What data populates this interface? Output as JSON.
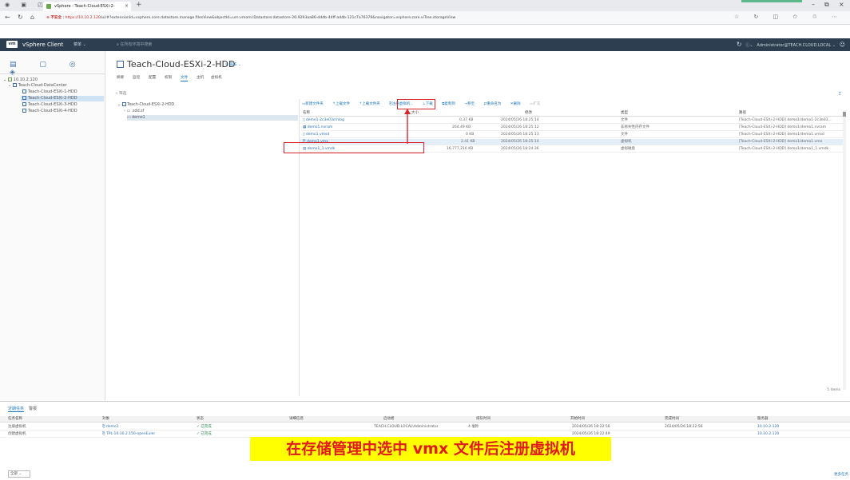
{
  "browser": {
    "tab_title": "vSphere - Teach-Cloud-ESXi-2-",
    "url_warning": "不安全",
    "url_host": "https://10.10.2.120",
    "url_rest": "/ui/#?extensionId=vsphere.core.datastore.manage.filesView&objectId=urn:vmomi:Datastore:datastore-26:9293aa86-dddb-44ff-ad4b-121c7a76379&navigator=vsphere.core.viTree.storageView"
  },
  "vsphere": {
    "logo": "vm",
    "title": "vSphere Client",
    "menu": "菜单",
    "search_placeholder": "在所有环境中搜索",
    "user": "Administrator@TEACH.CLOUD.LOCAL"
  },
  "nav": {
    "host": "10.10.2.120",
    "datacenter": "Teach-Cloud-DataCenter",
    "datastores": [
      "Teach-Cloud-ESXi-1-HDD",
      "Teach-Cloud-ESXi-2-HDD",
      "Teach-Cloud-ESXi-3-HDD",
      "Teach-Cloud-ESXi-4-HDD"
    ]
  },
  "main": {
    "title": "Teach-Cloud-ESXi-2-HDD",
    "actions": "操作",
    "tabs": [
      "摘要",
      "监控",
      "配置",
      "权限",
      "文件",
      "主机",
      "虚拟机"
    ],
    "filter": "筛选",
    "tree": {
      "root": "Teach-Cloud-ESXi-2-HDD",
      "items": [
        ".sdd.sf",
        "demo1"
      ]
    }
  },
  "toolbar": {
    "new_folder": "新建文件夹",
    "upload_files": "上载文件",
    "upload_folder": "上载文件夹",
    "register_vm": "注册虚拟机...",
    "download": "下载",
    "copy_to": "复制到",
    "move_to": "移至",
    "rename": "重命名为",
    "delete": "删除",
    "inflate": "扩充"
  },
  "grid": {
    "headers": [
      "名称",
      "大小",
      "修改",
      "类型",
      "路径"
    ],
    "rows": [
      {
        "name": "demo1-2c3e03d.hlog",
        "size": "0.37 KB",
        "modified": "2024/05/26 18:25:14",
        "type": "文件",
        "path": "[Teach-Cloud-ESXi-2-HDD] demo1/demo1-2c3e03..."
      },
      {
        "name": "demo1.nvram",
        "size": "264.49 KB",
        "modified": "2024/05/26 18:25:12",
        "type": "非易失性内存文件",
        "path": "[Teach-Cloud-ESXi-2-HDD] demo1/demo1.nvram"
      },
      {
        "name": "demo1.vmsd",
        "size": "0 KB",
        "modified": "2024/05/26 18:25:13",
        "type": "文件",
        "path": "[Teach-Cloud-ESXi-2-HDD] demo1/demo1.vmsd"
      },
      {
        "name": "demo1.vmx",
        "size": "2.41 KB",
        "modified": "2024/05/26 18:25:14",
        "type": "虚拟机",
        "path": "[Teach-Cloud-ESXi-2-HDD] demo1/demo1.vmx"
      },
      {
        "name": "demo1_1.vmdk",
        "size": "16,777,216 KB",
        "modified": "2024/05/26 18:24:36",
        "type": "虚拟磁盘",
        "path": "[Teach-Cloud-ESXi-2-HDD] demo1/demo1_1.vmdk"
      }
    ],
    "footer": "5 items"
  },
  "tasks": {
    "tabs": [
      "近期任务",
      "警报"
    ],
    "headers": [
      "任务名称",
      "对象",
      "状态",
      "详细信息",
      "启动者",
      "排队时间",
      "开始时间",
      "完成时间",
      "服务器"
    ],
    "rows": [
      {
        "name": "注册虚拟机",
        "object": "demo1",
        "status": "已完成",
        "initiator": "TEACH.CLOUD.LOCAL\\Administrator",
        "queued": "4 毫秒",
        "start": "2024/05/26 18:22:56",
        "end": "2024/05/26 18:22:56",
        "server": "10.10.2.120"
      },
      {
        "name": "创建虚拟机",
        "object": "TPL-10.10.2.150-openEuler",
        "status": "已完成",
        "initiator": "",
        "queued": "",
        "start": "2024/05/26 18:22:49",
        "end": "",
        "server": "10.10.2.120"
      }
    ],
    "filter": "全部",
    "more": "更多任务"
  },
  "caption": "在存储管理中选中 vmx 文件后注册虚拟机",
  "colors": {
    "header": "#2c3e50",
    "link": "#1a73b8",
    "highlight": "#d9262c",
    "caption_bg": "#ffff00",
    "caption_fg": "#e01b1b"
  }
}
